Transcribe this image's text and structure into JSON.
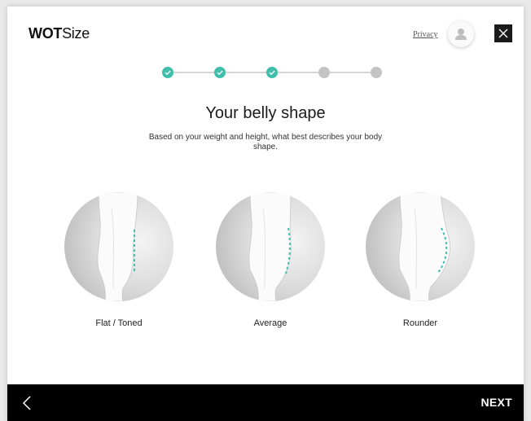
{
  "brand": {
    "bold": "WOT",
    "regular": "Size"
  },
  "header": {
    "privacy_label": "Privacy",
    "avatar_icon": "user-icon",
    "close_icon": "close-icon"
  },
  "progress": {
    "total_steps": 5,
    "completed_steps": 3,
    "accent_color": "#3fbfad",
    "inactive_color": "#c4c4c4"
  },
  "question": {
    "title": "Your belly shape",
    "subtitle": "Based on your weight and height, what best describes your body shape."
  },
  "options": [
    {
      "label": "Flat / Toned"
    },
    {
      "label": "Average"
    },
    {
      "label": "Rounder"
    }
  ],
  "footer": {
    "back_icon": "chevron-left-icon",
    "next_label": "NEXT"
  }
}
